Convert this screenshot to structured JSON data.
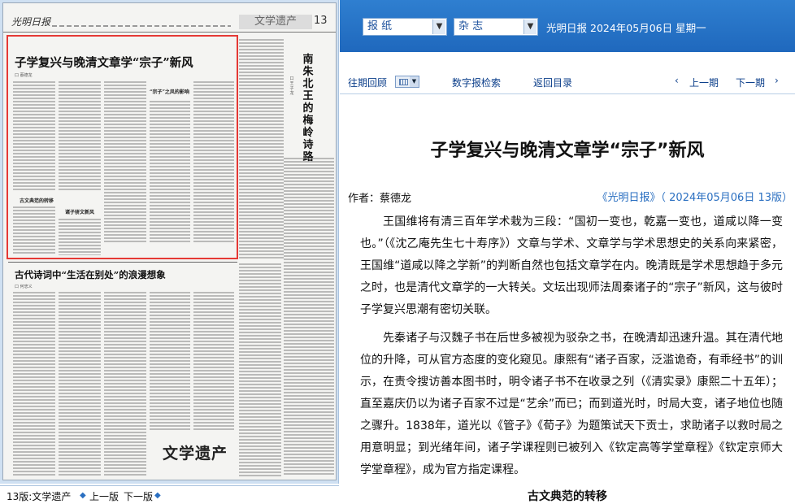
{
  "paper_page": {
    "masthead_logo": "光明日报",
    "section": "文学遗产",
    "page_number": "13",
    "headline_1": "子学复兴与晚清文章学“宗子”新风",
    "author_1": "口 蔡德龙",
    "side_headline": "南朱北王的梅岭诗路",
    "side_author": "口 王子龙",
    "subhead_a": "古文典范的转移",
    "subhead_b": "诸子骈文新风",
    "subhead_c": "“宗子”之风的影响",
    "headline_2": "古代诗词中“生活在别处”的浪漫想象",
    "author_2": "口 何忠义",
    "stamp": "文学遗产"
  },
  "paper_footer": {
    "section_label": "13版:文学遗产",
    "prev_page": "上一版",
    "next_page": "下一版"
  },
  "topbar": {
    "select_paper": "报 纸",
    "select_magazine": "杂 志",
    "publication": "光明日报",
    "date": "2024年05月06日",
    "weekday": "星期一"
  },
  "nav": {
    "archive": "往期回顾",
    "search": "数字报检索",
    "back": "返回目录",
    "prev": "上一期",
    "next": "下一期"
  },
  "article": {
    "title": "子学复兴与晚清文章学“宗子”新风",
    "author": "作者：蔡德龙",
    "source": "《光明日报》（ 2024年05月06日   13版）",
    "paragraphs": [
      "王国维将有清三百年学术栽为三段：“国初一变也，乾嘉一变也，道咸以降一变也。”（《沈乙庵先生七十寿序》）文章与学术、文章学与学术思想史的关系向来紧密，王国维“道咸以降之学新”的判断自然也包括文章学在内。晚清既是学术思想趋于多元之时，也是清代文章学的一大转关。文坛出现师法周秦诸子的“宗子”新风，这与彼时子学复兴思潮有密切关联。",
      "先秦诸子与汉魏子书在后世多被视为驳杂之书，在晚清却迅速升温。其在清代地位的升降，可从官方态度的变化窥见。康熙有“诸子百家，泛滥诡奇，有乖经书”的训示，在责令搜访善本图书时，明令诸子书不在收录之列（《清实录》康熙二十五年）；直至嘉庆仍以为诸子百家不过是“艺余”而已；而到道光时，时局大变，诸子地位也随之骤升。1838年，道光以《管子》《荀子》为题策试天下贡士，求助诸子以救时局之用意明显；到光绪年间，诸子学课程则已被列入《钦定高等学堂章程》《钦定京师大学堂章程》，成为官方指定课程。"
    ],
    "subhead": "古文典范的转移"
  }
}
